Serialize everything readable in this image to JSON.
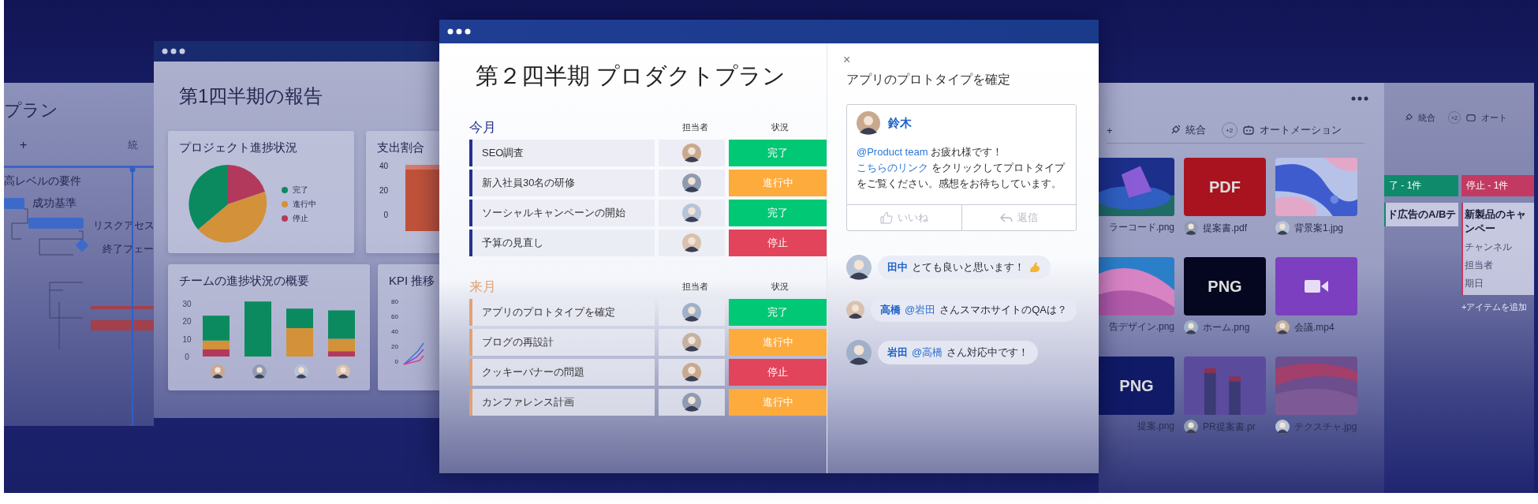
{
  "gantt_window": {
    "title": "プラン",
    "toolbar": [
      "+",
      "統"
    ],
    "tasks": [
      "高レベルの要件",
      "成功基準",
      "リスクアセス",
      "終了フェー"
    ]
  },
  "report_window": {
    "title": "第1四半期の報告",
    "status_card": {
      "title": "プロジェクト進捗状況",
      "legend": [
        {
          "label": "完了",
          "color": "#0b8a60"
        },
        {
          "label": "進行中",
          "color": "#d3913a"
        },
        {
          "label": "停止",
          "color": "#b3395c"
        }
      ]
    },
    "spend_card": {
      "title": "支出割合",
      "y_ticks": [
        "40",
        "20",
        "0"
      ]
    },
    "team_card": {
      "title": "チームの進捗状況の概要",
      "chart_data": {
        "type": "bar",
        "stacked": true,
        "ylim": [
          0,
          32
        ],
        "yticks": [
          0,
          10,
          20,
          30
        ],
        "series": [
          {
            "color": "#b3395c",
            "values": [
              4,
              0,
              0,
              3
            ]
          },
          {
            "color": "#d3913a",
            "values": [
              5,
              0,
              16,
              7
            ]
          },
          {
            "color": "#0b8a60",
            "values": [
              14,
              31,
              11,
              16
            ]
          }
        ]
      }
    },
    "kpi_card": {
      "title": "KPI 推移",
      "y_ticks": [
        "80",
        "60",
        "40",
        "20",
        "0"
      ]
    }
  },
  "plan_window": {
    "title": "第２四半期 プロダクトプラン",
    "groups": [
      {
        "title": "今月",
        "color": "#25308f",
        "columns": [
          "担当者",
          "状況"
        ],
        "rows": [
          {
            "name": "SEO調査",
            "status": "完了",
            "kind": "done"
          },
          {
            "name": "新入社員30名の研修",
            "status": "進行中",
            "kind": "working"
          },
          {
            "name": "ソーシャルキャンペーンの開始",
            "status": "完了",
            "kind": "done"
          },
          {
            "name": "予算の見直し",
            "status": "停止",
            "kind": "stuck"
          }
        ]
      },
      {
        "title": "来月",
        "color": "#e0a276",
        "columns": [
          "担当者",
          "状況"
        ],
        "rows": [
          {
            "name": "アプリのプロトタイプを確定",
            "status": "完了",
            "kind": "done"
          },
          {
            "name": "ブログの再設計",
            "status": "進行中",
            "kind": "working"
          },
          {
            "name": "クッキーバナーの問題",
            "status": "停止",
            "kind": "stuck"
          },
          {
            "name": "カンファレンス計画",
            "status": "進行中",
            "kind": "working"
          }
        ]
      }
    ]
  },
  "comment_panel": {
    "close": "×",
    "title": "アプリのプロトタイプを確定",
    "post": {
      "author": "鈴木",
      "body": [
        {
          "kind": "mention",
          "text": "@Product team"
        },
        {
          "kind": "text",
          "text": " お疲れ様です！ "
        },
        {
          "kind": "link",
          "text": "こちらのリンク"
        },
        {
          "kind": "text",
          "text": " をクリックしてプロトタイプをご覧ください。感想をお待ちしています。"
        }
      ],
      "actions": [
        {
          "label": "いいね",
          "kind": "like"
        },
        {
          "label": "返信",
          "kind": "reply"
        }
      ]
    },
    "replies": [
      {
        "author": "田中",
        "text": "とても良いと思います！",
        "emoji": true
      },
      {
        "author": "高橋",
        "mention": "@岩田",
        "text": "さんスマホサイトのQAは？",
        "emoji": false
      },
      {
        "author": "岩田",
        "mention": "@高橋",
        "text": "さん対応中です！",
        "emoji": false
      }
    ]
  },
  "files_window": {
    "toolbar": {
      "add": "+",
      "integrate": "統合",
      "badge": "+2",
      "automation": "オートメーション"
    },
    "files": [
      {
        "name": "ラーコード.png",
        "kind": "picture",
        "avatar": false
      },
      {
        "name": "提案書.pdf",
        "kind": "label",
        "tile_text": "PDF",
        "color": "#a8131f",
        "avatar": true
      },
      {
        "name": "背景案1.jpg",
        "kind": "picture",
        "avatar": true
      },
      {
        "name": "告デザイン.png",
        "kind": "picture",
        "avatar": false
      },
      {
        "name": "ホーム.png",
        "kind": "label",
        "tile_text": "PNG",
        "color": "#05061f",
        "avatar": true
      },
      {
        "name": "会議.mp4",
        "kind": "video",
        "color": "#7b3fc0",
        "avatar": true
      },
      {
        "name": "提案.png",
        "kind": "label",
        "tile_text": "PNG",
        "color": "#101a66",
        "avatar": false
      },
      {
        "name": "PR提案書.pr",
        "kind": "picture",
        "avatar": true
      },
      {
        "name": "テクスチャ.jpg",
        "kind": "picture",
        "avatar": true
      }
    ]
  },
  "board_window": {
    "toolbar": {
      "integrate": "統合",
      "badge": "+2",
      "automation": "オート"
    },
    "columns": [
      {
        "header": "了 - 1件",
        "color": "#0f8a6a",
        "card": "ド広告のA/Bテ"
      },
      {
        "header": "停止 - 1件",
        "color": "#c23a62",
        "card": "新製品のキャンペー",
        "fields": [
          "チャンネル",
          "担当者",
          "期日"
        ],
        "add": "+アイテムを追加"
      }
    ]
  }
}
